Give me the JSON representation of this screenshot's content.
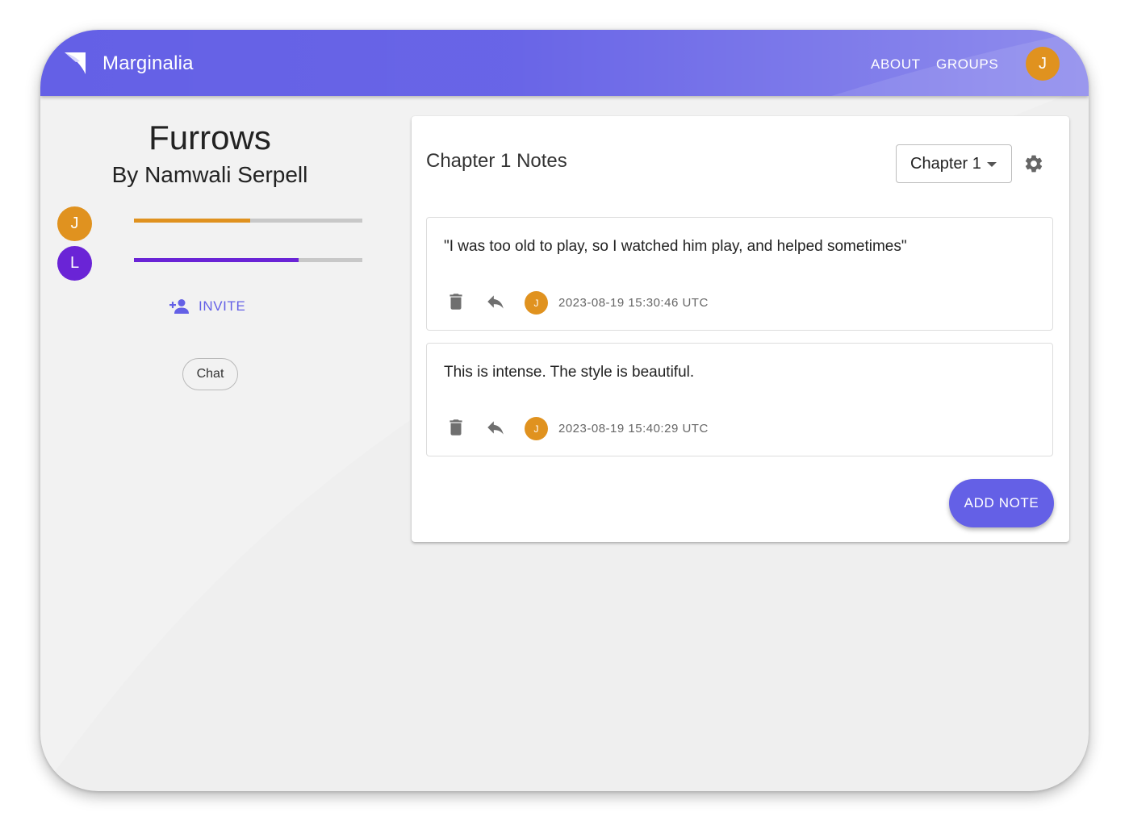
{
  "app": {
    "brand": "Marginalia",
    "nav": [
      {
        "label": "ABOUT"
      },
      {
        "label": "GROUPS"
      }
    ],
    "user_initial": "J"
  },
  "book": {
    "title": "Furrows",
    "author": "By Namwali Serpell"
  },
  "members": [
    {
      "initial": "J",
      "color": "#e0921f",
      "progress": 0.51
    },
    {
      "initial": "L",
      "color": "#6a24d6",
      "progress": 0.72
    }
  ],
  "invite_label": "INVITE",
  "chat_label": "Chat",
  "notes_panel": {
    "title": "Chapter 1 Notes",
    "chapter_selected": "Chapter 1",
    "add_note_label": "ADD NOTE",
    "notes": [
      {
        "text": "\"I was too old to play, so I watched him play, and helped sometimes\"",
        "author_initial": "J",
        "timestamp": "2023-08-19 15:30:46 UTC"
      },
      {
        "text": "This is intense. The style is beautiful.",
        "author_initial": "J",
        "timestamp": "2023-08-19 15:40:29 UTC"
      }
    ]
  },
  "colors": {
    "primary": "#6460e6",
    "user_orange": "#e0921f",
    "member_purple": "#6a24d6",
    "background": "#efefef"
  },
  "icons": {
    "logo": "marginalia-logo-icon",
    "invite": "person-add-icon",
    "settings": "gear-icon",
    "delete": "trash-icon",
    "reply": "reply-icon"
  }
}
